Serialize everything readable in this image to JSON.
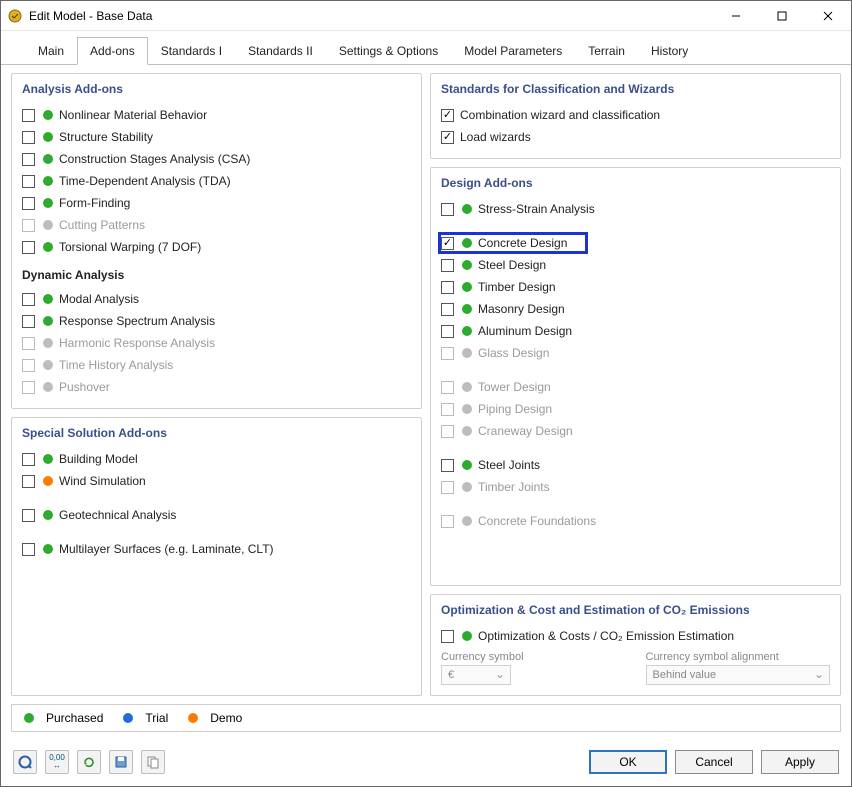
{
  "title": "Edit Model - Base Data",
  "tabs": [
    "Main",
    "Add-ons",
    "Standards I",
    "Standards II",
    "Settings & Options",
    "Model Parameters",
    "Terrain",
    "History"
  ],
  "active_tab": 1,
  "left": {
    "analysis": {
      "title": "Analysis Add-ons",
      "items": [
        {
          "label": "Nonlinear Material Behavior",
          "dot": "green",
          "checked": false,
          "disabled": false
        },
        {
          "label": "Structure Stability",
          "dot": "green",
          "checked": false,
          "disabled": false
        },
        {
          "label": "Construction Stages Analysis (CSA)",
          "dot": "green",
          "checked": false,
          "disabled": false
        },
        {
          "label": "Time-Dependent Analysis (TDA)",
          "dot": "green",
          "checked": false,
          "disabled": false
        },
        {
          "label": "Form-Finding",
          "dot": "green",
          "checked": false,
          "disabled": false
        },
        {
          "label": "Cutting Patterns",
          "dot": "grey",
          "checked": false,
          "disabled": true
        },
        {
          "label": "Torsional Warping (7 DOF)",
          "dot": "green",
          "checked": false,
          "disabled": false
        }
      ],
      "dynamic_title": "Dynamic Analysis",
      "dynamic_items": [
        {
          "label": "Modal Analysis",
          "dot": "green",
          "checked": false,
          "disabled": false
        },
        {
          "label": "Response Spectrum Analysis",
          "dot": "green",
          "checked": false,
          "disabled": false
        },
        {
          "label": "Harmonic Response Analysis",
          "dot": "grey",
          "checked": false,
          "disabled": true
        },
        {
          "label": "Time History Analysis",
          "dot": "grey",
          "checked": false,
          "disabled": true
        },
        {
          "label": "Pushover",
          "dot": "grey",
          "checked": false,
          "disabled": true
        }
      ]
    },
    "special": {
      "title": "Special Solution Add-ons",
      "items": [
        {
          "label": "Building Model",
          "dot": "green",
          "checked": false,
          "disabled": false
        },
        {
          "label": "Wind Simulation",
          "dot": "orange",
          "checked": false,
          "disabled": false
        }
      ],
      "items2": [
        {
          "label": "Geotechnical Analysis",
          "dot": "green",
          "checked": false,
          "disabled": false
        }
      ],
      "items3": [
        {
          "label": "Multilayer Surfaces (e.g. Laminate, CLT)",
          "dot": "green",
          "checked": false,
          "disabled": false
        }
      ]
    }
  },
  "right": {
    "standards": {
      "title": "Standards for Classification and Wizards",
      "items": [
        {
          "label": "Combination wizard and classification",
          "checked": true
        },
        {
          "label": "Load wizards",
          "checked": true
        }
      ]
    },
    "design": {
      "title": "Design Add-ons",
      "groups": [
        [
          {
            "label": "Stress-Strain Analysis",
            "dot": "green",
            "checked": false,
            "disabled": false
          }
        ],
        [
          {
            "label": "Concrete Design",
            "dot": "green",
            "checked": true,
            "disabled": false,
            "highlight": true
          },
          {
            "label": "Steel Design",
            "dot": "green",
            "checked": false,
            "disabled": false
          },
          {
            "label": "Timber Design",
            "dot": "green",
            "checked": false,
            "disabled": false
          },
          {
            "label": "Masonry Design",
            "dot": "green",
            "checked": false,
            "disabled": false
          },
          {
            "label": "Aluminum Design",
            "dot": "green",
            "checked": false,
            "disabled": false
          },
          {
            "label": "Glass Design",
            "dot": "grey",
            "checked": false,
            "disabled": true
          }
        ],
        [
          {
            "label": "Tower Design",
            "dot": "grey",
            "checked": false,
            "disabled": true
          },
          {
            "label": "Piping Design",
            "dot": "grey",
            "checked": false,
            "disabled": true
          },
          {
            "label": "Craneway Design",
            "dot": "grey",
            "checked": false,
            "disabled": true
          }
        ],
        [
          {
            "label": "Steel Joints",
            "dot": "green",
            "checked": false,
            "disabled": false
          },
          {
            "label": "Timber Joints",
            "dot": "grey",
            "checked": false,
            "disabled": true
          }
        ],
        [
          {
            "label": "Concrete Foundations",
            "dot": "grey",
            "checked": false,
            "disabled": true
          }
        ]
      ]
    },
    "optimization": {
      "title": "Optimization & Cost and Estimation of CO₂ Emissions",
      "item": {
        "label": "Optimization & Costs / CO₂ Emission Estimation",
        "dot": "green",
        "checked": false,
        "disabled": false
      },
      "currency_label": "Currency symbol",
      "currency_value": "€",
      "align_label": "Currency symbol alignment",
      "align_value": "Behind value"
    }
  },
  "legend": {
    "purchased": "Purchased",
    "trial": "Trial",
    "demo": "Demo"
  },
  "buttons": {
    "ok": "OK",
    "cancel": "Cancel",
    "apply": "Apply"
  }
}
